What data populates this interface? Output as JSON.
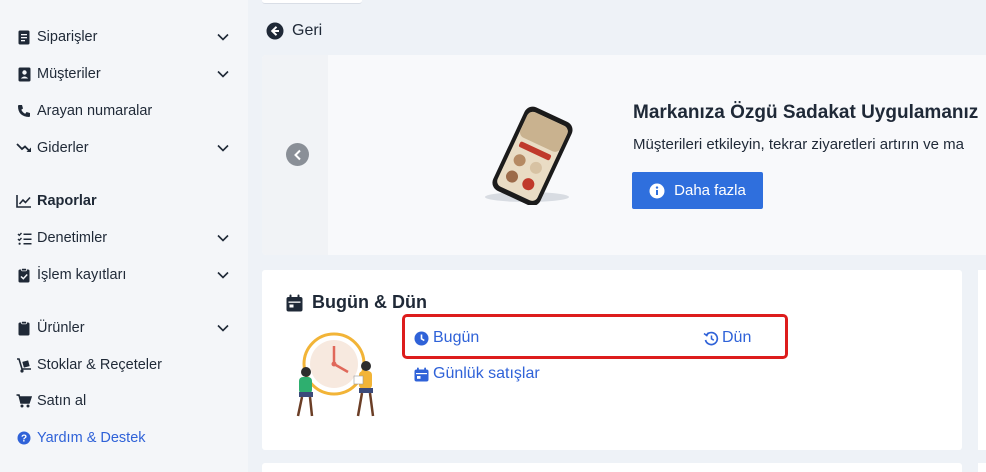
{
  "sidebar": {
    "items": [
      {
        "label": "Siparişler",
        "icon": "receipt-icon"
      },
      {
        "label": "Müşteriler",
        "icon": "contact-book-icon"
      },
      {
        "label": "Arayan numaralar",
        "icon": "phone-icon"
      },
      {
        "label": "Giderler",
        "icon": "trend-down-icon"
      },
      {
        "label": "Raporlar",
        "icon": "line-chart-icon"
      },
      {
        "label": "Denetimler",
        "icon": "checklist-icon"
      },
      {
        "label": "İşlem kayıtları",
        "icon": "clipboard-check-icon"
      },
      {
        "label": "Ürünler",
        "icon": "clipboard-icon"
      },
      {
        "label": "Stoklar & Reçeteler",
        "icon": "dolly-icon"
      },
      {
        "label": "Satın al",
        "icon": "cart-icon"
      },
      {
        "label": "Yardım & Destek",
        "icon": "help-circle-icon"
      }
    ]
  },
  "back": {
    "label": "Geri"
  },
  "banner": {
    "title": "Markanıza Özgü Sadakat Uygulamanız",
    "subtitle": "Müşterileri etkileyin, tekrar ziyaretleri artırın ve ma",
    "button_label": "Daha fazla"
  },
  "card": {
    "title": "Bugün & Dün",
    "links": {
      "today": "Bugün",
      "yesterday": "Dün",
      "daily_sales": "Günlük satışlar"
    }
  },
  "colors": {
    "accent": "#2f62d8",
    "button": "#2f6fdd",
    "highlight": "#dd1c1c"
  }
}
